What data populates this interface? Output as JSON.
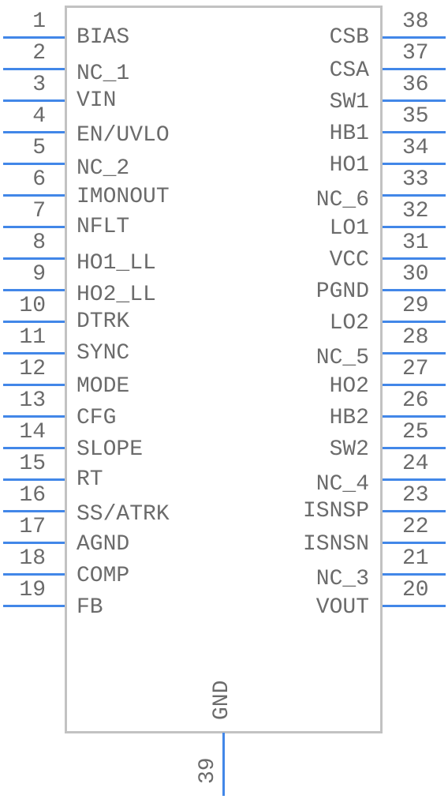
{
  "component": {
    "left_pins": [
      {
        "num": "1",
        "name": "BIAS"
      },
      {
        "num": "2",
        "name": "NC_1"
      },
      {
        "num": "3",
        "name": "VIN"
      },
      {
        "num": "4",
        "name": "EN/UVLO"
      },
      {
        "num": "5",
        "name": "NC_2"
      },
      {
        "num": "6",
        "name": "IMONOUT"
      },
      {
        "num": "7",
        "name": "NFLT"
      },
      {
        "num": "8",
        "name": "HO1_LL"
      },
      {
        "num": "9",
        "name": "HO2_LL"
      },
      {
        "num": "10",
        "name": "DTRK"
      },
      {
        "num": "11",
        "name": "SYNC"
      },
      {
        "num": "12",
        "name": "MODE"
      },
      {
        "num": "13",
        "name": "CFG"
      },
      {
        "num": "14",
        "name": "SLOPE"
      },
      {
        "num": "15",
        "name": "RT"
      },
      {
        "num": "16",
        "name": "SS/ATRK"
      },
      {
        "num": "17",
        "name": "AGND"
      },
      {
        "num": "18",
        "name": "COMP"
      },
      {
        "num": "19",
        "name": "FB"
      }
    ],
    "right_pins": [
      {
        "num": "38",
        "name": "CSB"
      },
      {
        "num": "37",
        "name": "CSA"
      },
      {
        "num": "36",
        "name": "SW1"
      },
      {
        "num": "35",
        "name": "HB1"
      },
      {
        "num": "34",
        "name": "HO1"
      },
      {
        "num": "33",
        "name": "NC_6"
      },
      {
        "num": "32",
        "name": "LO1"
      },
      {
        "num": "31",
        "name": "VCC"
      },
      {
        "num": "30",
        "name": "PGND"
      },
      {
        "num": "29",
        "name": "LO2"
      },
      {
        "num": "28",
        "name": "NC_5"
      },
      {
        "num": "27",
        "name": "HO2"
      },
      {
        "num": "26",
        "name": "HB2"
      },
      {
        "num": "25",
        "name": "SW2"
      },
      {
        "num": "24",
        "name": "NC_4"
      },
      {
        "num": "23",
        "name": "ISNSP"
      },
      {
        "num": "22",
        "name": "ISNSN"
      },
      {
        "num": "21",
        "name": "NC_3"
      },
      {
        "num": "20",
        "name": "VOUT"
      }
    ],
    "bottom_pin": {
      "num": "39",
      "name": "GND"
    },
    "colors": {
      "pin": "#4287e8",
      "outline": "#c2c2c2",
      "text": "#6b6b6b"
    }
  }
}
